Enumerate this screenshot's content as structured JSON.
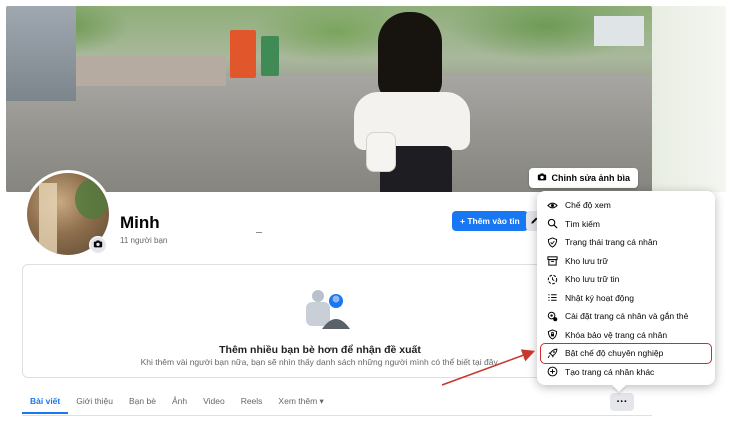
{
  "cover": {
    "edit_button": "Chỉnh sửa ảnh bìa"
  },
  "profile": {
    "name": "Minh",
    "friend_count": "11 người bạn",
    "add_story_label": "+ Thêm vào tin"
  },
  "suggestions": {
    "title": "Thêm nhiều bạn bè hơn để nhận đề xuất",
    "description": "Khi thêm vài người bạn nữa, bạn sẽ nhìn thấy danh sách những người mình có thể biết tại đây."
  },
  "tabs": [
    {
      "label": "Bài viết",
      "active": true
    },
    {
      "label": "Giới thiệu"
    },
    {
      "label": "Bạn bè"
    },
    {
      "label": "Ảnh"
    },
    {
      "label": "Video"
    },
    {
      "label": "Reels"
    },
    {
      "label": "Xem thêm ▾"
    }
  ],
  "more_button_label": "···",
  "menu": {
    "items": [
      {
        "label": "Chế độ xem",
        "icon": "eye-icon"
      },
      {
        "label": "Tìm kiếm",
        "icon": "search-icon"
      },
      {
        "label": "Trạng thái trang cá nhân",
        "icon": "shield-status-icon"
      },
      {
        "label": "Kho lưu trữ",
        "icon": "archive-icon"
      },
      {
        "label": "Kho lưu trữ tin",
        "icon": "story-archive-icon"
      },
      {
        "label": "Nhật ký hoạt động",
        "icon": "activity-log-icon"
      },
      {
        "label": "Cài đặt trang cá nhân và gắn thẻ",
        "icon": "settings-tag-icon"
      },
      {
        "label": "Khóa bảo vệ trang cá nhân",
        "icon": "lock-shield-icon"
      },
      {
        "label": "Bật chế độ chuyên nghiệp",
        "icon": "rocket-icon",
        "highlighted": true
      },
      {
        "label": "Tạo trang cá nhân khác",
        "icon": "plus-circle-icon"
      }
    ]
  },
  "colors": {
    "accent": "#1877f2",
    "highlight_box": "#d42a2a",
    "annotation_arrow": "#c8372b"
  }
}
